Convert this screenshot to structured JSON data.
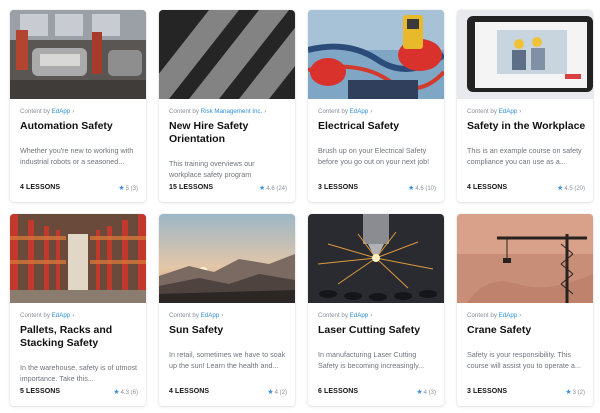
{
  "colors": {
    "provider_link": "#2f8fd8",
    "star": "#3b8fe0"
  },
  "icons": {
    "star": "star-icon",
    "chevron": "chevron-right-icon"
  },
  "courses": [
    {
      "content_by": "Content by",
      "provider": "EdApp",
      "chevron": "›",
      "title": "Automation Safety",
      "description": "Whether you're new to working with industrial robots or a seasoned...",
      "lessons": "4 LESSONS",
      "star": "★",
      "rating": "5",
      "reviews": "(3)"
    },
    {
      "content_by": "Content by",
      "provider": "Risk Management Inc.",
      "chevron": "›",
      "title": "New Hire Safety Orientation",
      "description": "This training overviews our workplace safety program",
      "lessons": "15 LESSONS",
      "star": "★",
      "rating": "4.6",
      "reviews": "(24)"
    },
    {
      "content_by": "Content by",
      "provider": "EdApp",
      "chevron": "›",
      "title": "Electrical Safety",
      "description": "Brush up on your Electrical Safety before you go out on your next job!",
      "lessons": "3 LESSONS",
      "star": "★",
      "rating": "4.6",
      "reviews": "(10)"
    },
    {
      "content_by": "Content by",
      "provider": "EdApp",
      "chevron": "›",
      "title": "Safety in the Workplace",
      "description": "This is an example course on safety compliance you can use as a...",
      "lessons": "4 LESSONS",
      "star": "★",
      "rating": "4.5",
      "reviews": "(20)"
    },
    {
      "content_by": "Content by",
      "provider": "EdApp",
      "chevron": "›",
      "title": "Pallets, Racks and Stacking Safety",
      "description": "In the warehouse, safety is of utmost importance. Take this...",
      "lessons": "5 LESSONS",
      "star": "★",
      "rating": "4.3",
      "reviews": "(6)"
    },
    {
      "content_by": "Content by",
      "provider": "EdApp",
      "chevron": "›",
      "title": "Sun Safety",
      "description": "In retail, sometimes we have to soak up the sun! Learn the health and...",
      "lessons": "4 LESSONS",
      "star": "★",
      "rating": "4",
      "reviews": "(2)"
    },
    {
      "content_by": "Content by",
      "provider": "EdApp",
      "chevron": "›",
      "title": "Laser Cutting Safety",
      "description": "In manufacturing Laser Cutting Safety is becoming increasingly...",
      "lessons": "6 LESSONS",
      "star": "★",
      "rating": "4",
      "reviews": "(3)"
    },
    {
      "content_by": "Content by",
      "provider": "EdApp",
      "chevron": "›",
      "title": "Crane Safety",
      "description": "Safety is your responsibility. This course will assist you to operate a...",
      "lessons": "3 LESSONS",
      "star": "★",
      "rating": "3",
      "reviews": "(2)"
    }
  ]
}
